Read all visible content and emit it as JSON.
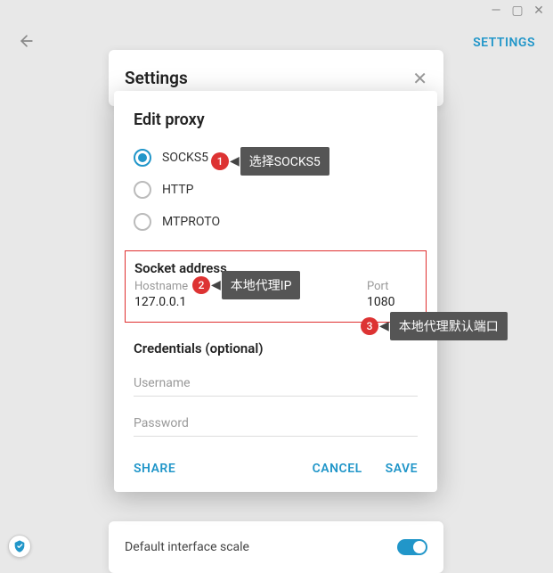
{
  "window": {
    "min": "—",
    "max": "▢",
    "close": "✕"
  },
  "top": {
    "settings_link": "SETTINGS"
  },
  "settings": {
    "title": "Settings",
    "close": "✕"
  },
  "modal": {
    "title": "Edit proxy",
    "radios": {
      "socks5": "SOCKS5",
      "http": "HTTP",
      "mtproto": "MTPROTO"
    },
    "socket": {
      "title": "Socket address",
      "hostname_label": "Hostname",
      "hostname_value": "127.0.0.1",
      "port_label": "Port",
      "port_value": "1080"
    },
    "creds": {
      "title": "Credentials (optional)",
      "username_placeholder": "Username",
      "password_placeholder": "Password"
    },
    "actions": {
      "share": "SHARE",
      "cancel": "CANCEL",
      "save": "SAVE"
    }
  },
  "bottom": {
    "scale_label": "Default interface scale"
  },
  "annotations": {
    "a1_num": "1",
    "a1_text": "选择SOCKS5",
    "a2_num": "2",
    "a2_text": "本地代理IP",
    "a3_num": "3",
    "a3_text": "本地代理默认端口"
  }
}
